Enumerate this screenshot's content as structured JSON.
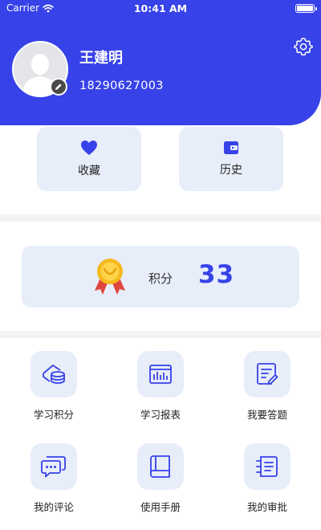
{
  "status_bar": {
    "carrier": "Carrier",
    "time": "10:41 AM"
  },
  "profile": {
    "name": "王建明",
    "phone": "18290627003"
  },
  "quick_actions": [
    {
      "label": "收藏",
      "icon": "heart-icon"
    },
    {
      "label": "历史",
      "icon": "wallet-icon"
    }
  ],
  "points": {
    "label": "积分",
    "value": "33",
    "icon": "medal-icon"
  },
  "grid": [
    {
      "label": "学习积分",
      "icon": "coins-icon"
    },
    {
      "label": "学习报表",
      "icon": "report-icon"
    },
    {
      "label": "我要答题",
      "icon": "quiz-icon"
    },
    {
      "label": "我的评论",
      "icon": "comment-icon"
    },
    {
      "label": "使用手册",
      "icon": "manual-icon"
    },
    {
      "label": "我的审批",
      "icon": "approval-icon"
    }
  ],
  "colors": {
    "primary": "#3742E8",
    "card_bg": "#E8EDFA",
    "divider": "#F2F3F5",
    "medal_gold": "#F5B91E",
    "medal_ribbon": "#E0473C"
  }
}
